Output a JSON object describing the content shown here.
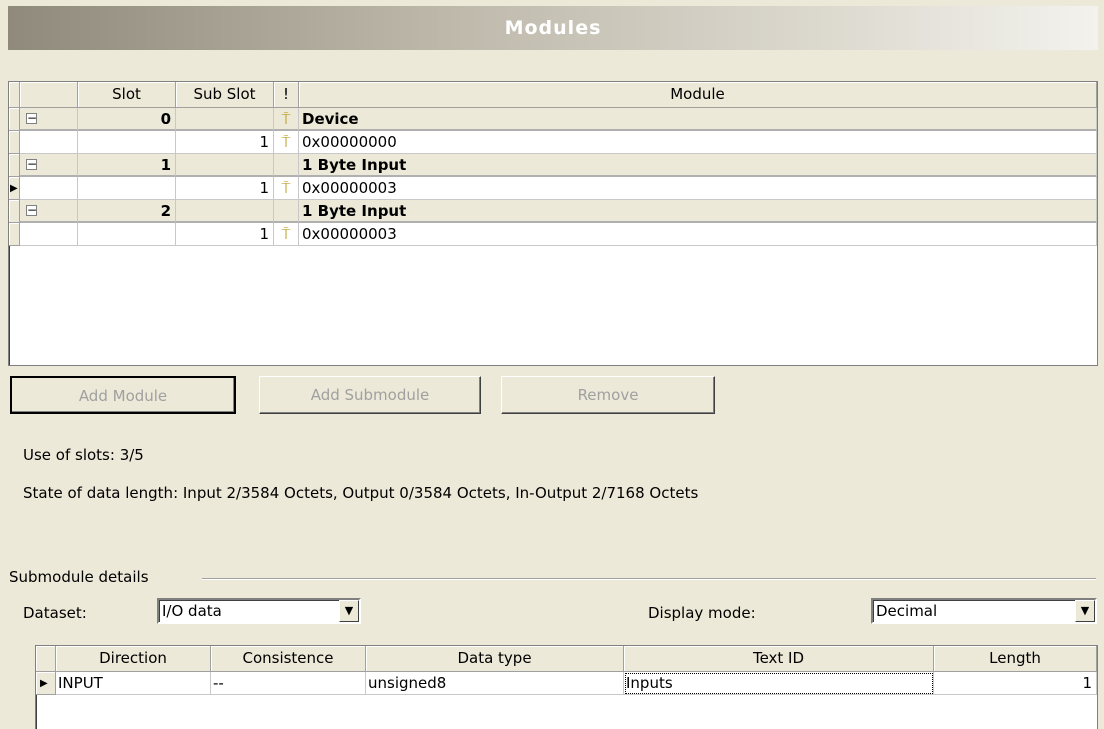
{
  "title": "Modules",
  "modules_grid": {
    "columns": [
      "Slot",
      "Sub Slot",
      "!",
      "Module"
    ],
    "rows": [
      {
        "type": "parent",
        "slot": "0",
        "subslot": "",
        "pin": "pin-icon",
        "module": "Device"
      },
      {
        "type": "child",
        "slot": "",
        "subslot": "1",
        "pin": "pin-icon",
        "module": "0x00000000"
      },
      {
        "type": "parent",
        "slot": "1",
        "subslot": "",
        "pin": "",
        "module": "1 Byte Input"
      },
      {
        "type": "child",
        "slot": "",
        "subslot": "1",
        "pin": "pin-icon",
        "module": "0x00000003",
        "current": true
      },
      {
        "type": "parent",
        "slot": "2",
        "subslot": "",
        "pin": "",
        "module": "1 Byte Input"
      },
      {
        "type": "child",
        "slot": "",
        "subslot": "1",
        "pin": "pin-icon",
        "module": "0x00000003"
      }
    ]
  },
  "buttons": {
    "add_module": "Add Module",
    "add_submodule": "Add Submodule",
    "remove": "Remove"
  },
  "status": {
    "use_of_slots": "Use of slots: 3/5",
    "data_length": "State of data length: Input 2/3584 Octets, Output 0/3584 Octets, In-Output 2/7168 Octets"
  },
  "submodule_details": {
    "group_label": "Submodule details",
    "dataset_label": "Dataset:",
    "dataset_value": "I/O data",
    "display_mode_label": "Display mode:",
    "display_mode_value": "Decimal",
    "columns": [
      "Direction",
      "Consistence",
      "Data type",
      "Text ID",
      "Length"
    ],
    "rows": [
      {
        "direction": "INPUT",
        "consistence": "--",
        "data_type": "unsigned8",
        "text_id": "Inputs",
        "length": "1"
      }
    ]
  }
}
